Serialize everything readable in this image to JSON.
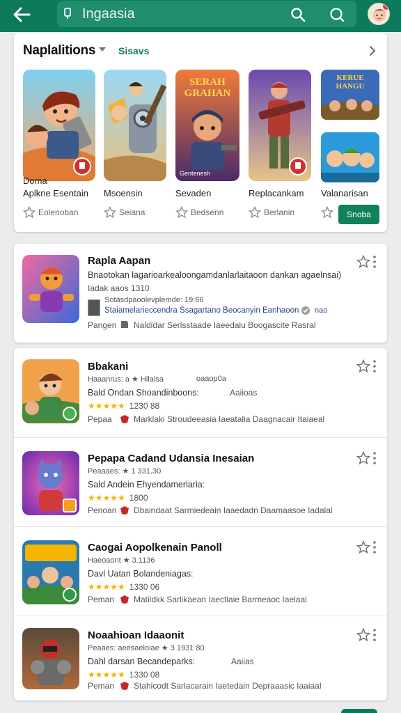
{
  "topbar": {
    "query": "Ingaasia",
    "colors": {
      "bar": "#0e7a5c",
      "accent": "#12805c"
    }
  },
  "featured": {
    "title": "Naplalitions",
    "tag": "Sisavs",
    "install_label": "Snoba",
    "apps": [
      {
        "name": "Aplkne Esentain",
        "extra": "Doma",
        "sub": "Eolenoban"
      },
      {
        "name": "Msoensin",
        "sub": "Seiana"
      },
      {
        "name": "Sevaden",
        "sub": "Bedsenn",
        "art_caption": "Gentenesh"
      },
      {
        "name": "Replacankam",
        "sub": "Berlanin"
      },
      {
        "name": "Valanarisan",
        "sub": ""
      }
    ],
    "tile_text": {
      "app3_banner": "SERAH GRAHAN",
      "app5_banner": "KERUE HANGU"
    }
  },
  "highlight": {
    "title": "Rapla Aapan",
    "line1": "Bnaotokan lagarioarkealoongamdanlarlaitaoon dankan agaelnsai)",
    "line2": "Iadak aaos 1310",
    "line3": "Sotasdpaoolevplemde: 19:66",
    "line4": "Staiamelarieccendra Ssagartano Beocanyin Eanhaoon",
    "line4_tail": "nao",
    "line5_label": "Pangen",
    "line5": "Naldidar Serlsstaade Iaeedalu Boogascite Rasral"
  },
  "list": [
    {
      "title": "Bbakani",
      "meta": "Haaanrus: a ★ Hilaisa",
      "meta_tail": "oaaop0a",
      "dev": "Bald Ondan Shoandinboons:",
      "dev_tail": "Aaiioas",
      "rating": "★★★★★",
      "count": "1230 88",
      "foot_label": "Pepaa",
      "foot": "Marklaki Stroudeeasia Iaeatalia Daagnacair Itaiaeal"
    },
    {
      "title": "Pepapa Cadand Udansia Inesaian",
      "meta": "Peaaaes: ★ 1 331.30",
      "meta_tail": "",
      "dev": "Sald Andein Ehyendamerlaria:",
      "dev_tail": "",
      "rating": "★★★★★",
      "count": "1800",
      "foot_label": "Penoan",
      "foot": "Dbaindaat Sarmiedeain Iaaedadn Daamaasoe Iadalal"
    },
    {
      "title": "Caogai Aopolkenain Panoll",
      "meta": "Haeoaont ★ 3.1136",
      "meta_tail": "",
      "dev": "Davl Uatan Bolandeniagas:",
      "dev_tail": "",
      "rating": "★★★★★",
      "count": "1330 06",
      "foot_label": "Peman",
      "foot": "Matildkk Sarlikaean Iaectlaie Barmeaoc Iaelaal"
    },
    {
      "title": "Noaahioan Idaaonit",
      "meta": "Peaaes: aeesaeloiae ★ 3 1931 80",
      "meta_tail": "",
      "dev": "Dahl darsan Becandeparks:",
      "dev_tail": "Aaiias",
      "rating": "★★★★★",
      "count": "1330 08",
      "foot_label": "Peman",
      "foot": "Stahicodt Sarlacarain Iaetedain Depraaasic Iaaiaal"
    }
  ]
}
